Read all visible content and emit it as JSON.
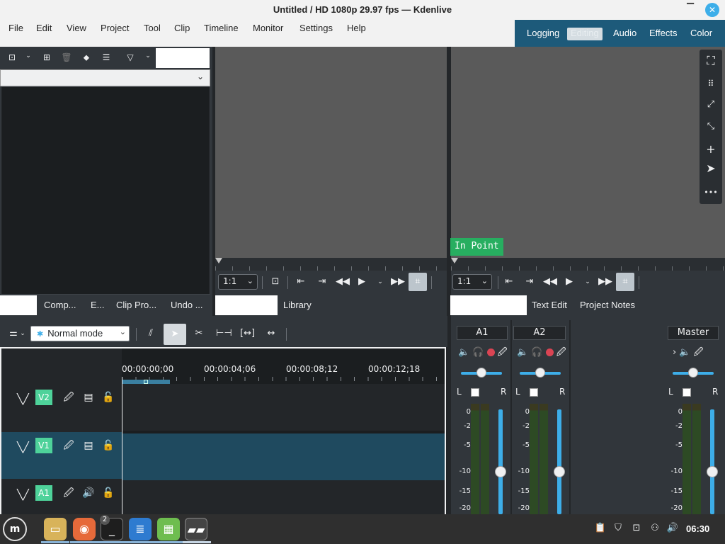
{
  "window": {
    "title": "Untitled / HD 1080p 29.97 fps — Kdenlive"
  },
  "menu": [
    "File",
    "Edit",
    "View",
    "Project",
    "Tool",
    "Clip",
    "Timeline",
    "Monitor",
    "Settings",
    "Help"
  ],
  "workspaces": {
    "items": [
      "Logging",
      "Editing",
      "Audio",
      "Effects",
      "Color"
    ],
    "active": "Editing"
  },
  "left_tabs": [
    "Comp...",
    "E...",
    "Clip Pro...",
    "Undo ..."
  ],
  "center_tabs": [
    "Library"
  ],
  "right_tabs": [
    "Text Edit",
    "Project Notes"
  ],
  "clip_monitor": {
    "zoom": "1:1"
  },
  "project_monitor": {
    "zoom": "1:1",
    "overlay": "In Point"
  },
  "timeline": {
    "mode": "Normal mode",
    "timecodes": [
      "00:00:00;00",
      "00:00:04;06",
      "00:00:08;12",
      "00:00:12;18"
    ],
    "tracks": [
      {
        "name": "V2",
        "type": "video"
      },
      {
        "name": "V1",
        "type": "video"
      },
      {
        "name": "A1",
        "type": "audio"
      }
    ]
  },
  "mixer": {
    "channels": [
      "A1",
      "A2",
      "Master"
    ],
    "left": "L",
    "right": "R",
    "db_scale": [
      "0",
      "-2",
      "-5",
      "-10",
      "-15",
      "-20"
    ]
  },
  "taskbar": {
    "terminal_badge": "2",
    "clock": "06:30"
  },
  "colors": {
    "accent": "#3daee9",
    "workspace_bar": "#1d5a7a",
    "track_label": "#4ed29a",
    "in_point": "#27ae60",
    "record": "#da4453"
  }
}
